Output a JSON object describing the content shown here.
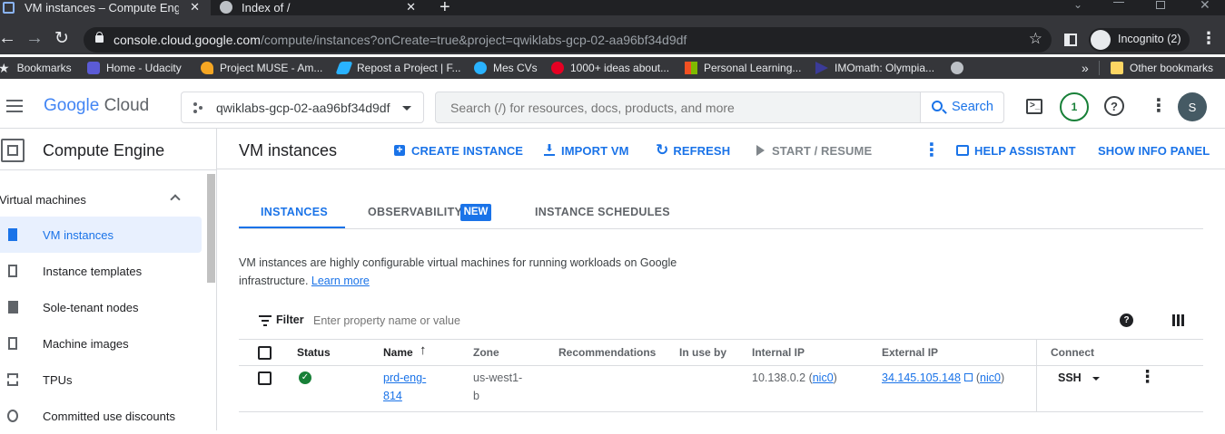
{
  "browser": {
    "tabs": [
      {
        "title": "VM instances – Compute Engine"
      },
      {
        "title": "Index of /"
      }
    ],
    "url_host": "console.cloud.google.com",
    "url_path": "/compute/instances?onCreate=true&project=qwiklabs-gcp-02-aa96bf34d9df",
    "incognito_label": "Incognito (2)",
    "bookmarks": [
      {
        "label": "Bookmarks",
        "icon": "star-icon",
        "color": "#e8eaed"
      },
      {
        "label": "Home - Udacity",
        "icon": "udacity-icon",
        "color": "#5b5bd6"
      },
      {
        "label": "Project MUSE - Am...",
        "icon": "muse-icon",
        "color": "#f5a623"
      },
      {
        "label": "Repost a Project | F...",
        "icon": "freelancer-icon",
        "color": "#29b2fe"
      },
      {
        "label": "Mes CVs",
        "icon": "cv-icon",
        "color": "#29b2fe"
      },
      {
        "label": "1000+ ideas about...",
        "icon": "pinterest-icon",
        "color": "#e60023"
      },
      {
        "label": "Personal Learning...",
        "icon": "microsoft-icon",
        "color": "#f25022"
      },
      {
        "label": "IMOmath: Olympia...",
        "icon": "imomath-icon",
        "color": "#3b3b98"
      },
      {
        "label": "",
        "icon": "globe-icon",
        "color": "#bdc1c6"
      }
    ],
    "more_bookmarks": "»",
    "other_bookmarks": "Other bookmarks"
  },
  "gcp": {
    "logo_google": "Google",
    "logo_cloud": "Cloud",
    "project": "qwiklabs-gcp-02-aa96bf34d9df",
    "search_placeholder": "Search (/) for resources, docs, products, and more",
    "search_button": "Search",
    "notifications_count": "1",
    "avatar_letter": "S",
    "colors": {
      "accent": "#1a73e8",
      "notif": "#188038",
      "avatar": "#455a64"
    }
  },
  "sidebar": {
    "product_title": "Compute Engine",
    "section": "Virtual machines",
    "items": [
      {
        "label": "VM instances",
        "active": true
      },
      {
        "label": "Instance templates"
      },
      {
        "label": "Sole-tenant nodes"
      },
      {
        "label": "Machine images"
      },
      {
        "label": "TPUs"
      },
      {
        "label": "Committed use discounts"
      }
    ]
  },
  "page": {
    "title": "VM instances",
    "actions": {
      "create": "CREATE INSTANCE",
      "import": "IMPORT VM",
      "refresh": "REFRESH",
      "start": "START / RESUME",
      "help": "HELP ASSISTANT",
      "info": "SHOW INFO PANEL"
    },
    "tabs": {
      "instances": "INSTANCES",
      "observability": "OBSERVABILITY",
      "new_badge": "NEW",
      "schedules": "INSTANCE SCHEDULES"
    },
    "description_1": "VM instances are highly configurable virtual machines for running workloads on Google",
    "description_2": "infrastructure.",
    "learn_more": "Learn more",
    "filter_label": "Filter",
    "filter_placeholder": "Enter property name or value",
    "columns": {
      "status": "Status",
      "name": "Name",
      "zone": "Zone",
      "recommendations": "Recommendations",
      "in_use_by": "In use by",
      "internal_ip": "Internal IP",
      "external_ip": "External IP",
      "connect": "Connect"
    },
    "row": {
      "name_1": "prd-eng-",
      "name_2": "814",
      "zone_1": "us-west1-",
      "zone_2": "b",
      "internal_ip": "10.138.0.2",
      "internal_nic": "nic0",
      "external_ip": "34.145.105.148",
      "external_nic": "nic0",
      "connect": "SSH",
      "status_color": "#188038"
    }
  }
}
